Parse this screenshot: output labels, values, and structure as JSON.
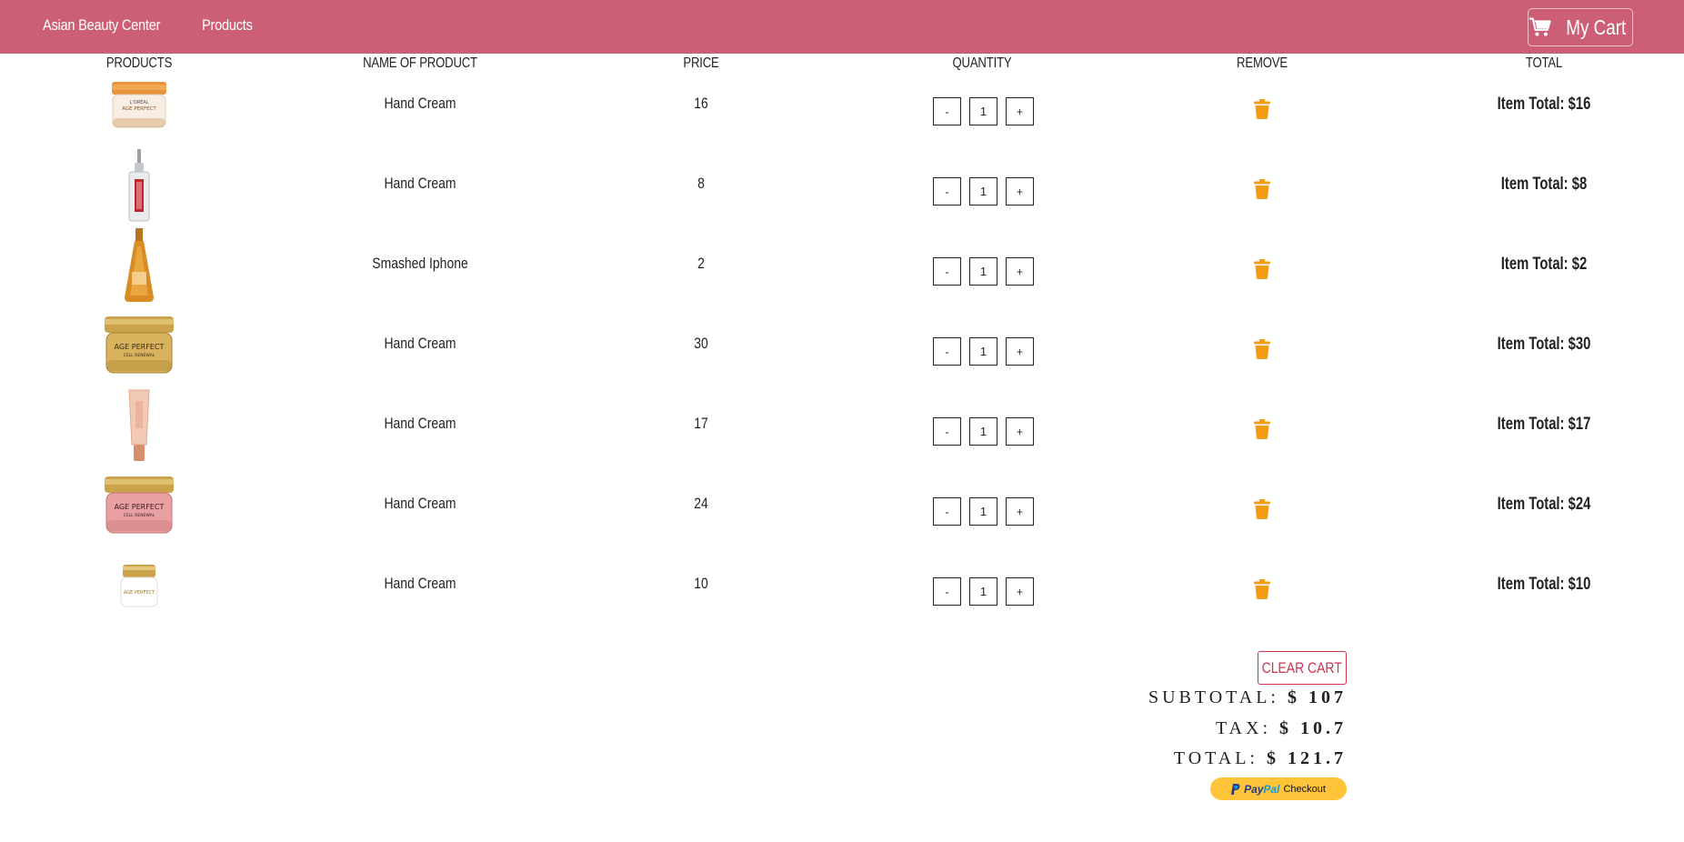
{
  "nav": {
    "brand": "Asian Beauty Center",
    "products_link": "Products",
    "cart_label": "My Cart",
    "bg_color": "#cc5f76"
  },
  "table": {
    "headers": [
      "PRODUCTS",
      "NAME OF PRODUCT",
      "PRICE",
      "QUANTITY",
      "REMOVE",
      "TOTAL"
    ],
    "rows": [
      {
        "image": "age-perfect-hydra-nutrition-jar",
        "name": "Hand Cream",
        "price": "16",
        "qty": "1",
        "total": "Item Total: $16"
      },
      {
        "image": "revitalift-serum-dropper-bottle",
        "name": "Hand Cream",
        "price": "8",
        "qty": "1",
        "total": "Item Total: $8"
      },
      {
        "image": "mythic-oil-amber-bottle",
        "name": "Smashed Iphone",
        "price": "2",
        "qty": "1",
        "total": "Item Total: $2"
      },
      {
        "image": "age-perfect-cell-renewal-night-cream-jar",
        "name": "Hand Cream",
        "price": "30",
        "qty": "1",
        "total": "Item Total: $30"
      },
      {
        "image": "tinted-cream-tube",
        "name": "Hand Cream",
        "price": "17",
        "qty": "1",
        "total": "Item Total: $17"
      },
      {
        "image": "age-perfect-rosy-cream-jar",
        "name": "Hand Cream",
        "price": "24",
        "qty": "1",
        "total": "Item Total: $24"
      },
      {
        "image": "age-perfect-small-white-jar",
        "name": "Hand Cream",
        "price": "10",
        "qty": "1",
        "total": "Item Total: $10"
      }
    ],
    "minus_label": "-",
    "plus_label": "+",
    "trash_icon_color": "#f39c12"
  },
  "summary": {
    "clear_cart": "CLEAR CART",
    "subtotal_label": "SUBTOTAL:",
    "subtotal_value": "$ 107",
    "tax_label": "TAX:",
    "tax_value": "$ 10.7",
    "total_label": "TOTAL:",
    "total_value": "$ 121.7",
    "paypal_pay": "Pay",
    "paypal_pal": "Pal",
    "paypal_checkout": "Checkout"
  }
}
